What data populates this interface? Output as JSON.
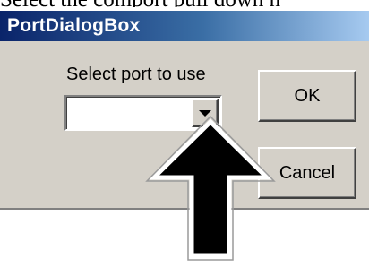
{
  "caption": {
    "text": "Select the comport pull down n"
  },
  "dialog": {
    "title": "PortDialogBox",
    "port_label": "Select port to use",
    "port_select": {
      "value": ""
    },
    "ok_label": "OK",
    "cancel_label": "Cancel"
  },
  "annotation": {
    "arrow_icon": "up-arrow-icon",
    "fill_color": "#000000",
    "outline_color": "#ffffff"
  },
  "colors": {
    "dialog_bg": "#d4d0c8",
    "titlebar_start": "#0a246a",
    "titlebar_end": "#a6caf0",
    "title_text": "#ffffff"
  }
}
